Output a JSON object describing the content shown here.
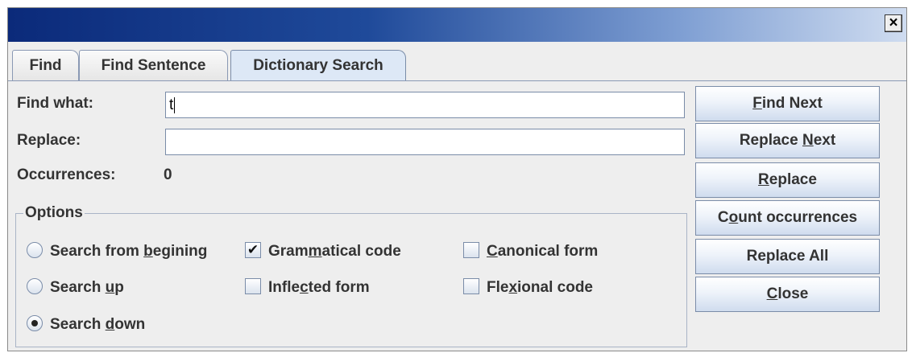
{
  "window": {
    "close_glyph": "×"
  },
  "tabs": [
    {
      "label": "Find"
    },
    {
      "label": "Find Sentence"
    },
    {
      "label": "Dictionary Search"
    }
  ],
  "active_tab": "Dictionary Search",
  "form": {
    "find_what_label": "Find what:",
    "find_what_value": "t",
    "replace_label": "Replace:",
    "replace_value": "",
    "occurrences_label": "Occurrences:",
    "occurrences_value": "0"
  },
  "options": {
    "title": "Options",
    "radios": [
      {
        "label": "Search from begining",
        "selected": false
      },
      {
        "label": "Search up",
        "selected": false
      },
      {
        "label": "Search down",
        "selected": true
      }
    ],
    "checkboxes": [
      {
        "label": "Grammatical code",
        "checked": true
      },
      {
        "label": "Inflected form",
        "checked": false
      },
      {
        "label": "Canonical form",
        "checked": false
      },
      {
        "label": "Flexional code",
        "checked": false
      }
    ]
  },
  "buttons": [
    {
      "label": "Find Next"
    },
    {
      "label": "Replace Next"
    },
    {
      "label": "Replace"
    },
    {
      "label": "Count occurrences"
    },
    {
      "label": "Replace All"
    },
    {
      "label": "Close"
    }
  ],
  "colors": {
    "titlebar_start": "#0b2a7a",
    "titlebar_end": "#cfdcf0",
    "dialog_bg": "#eeeeee",
    "active_tab_bg": "#dde8f6",
    "border": "#7a8ca8"
  }
}
